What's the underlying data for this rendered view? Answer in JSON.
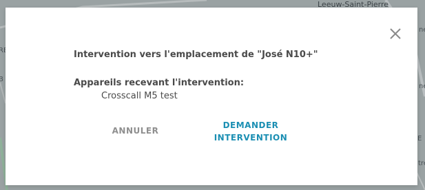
{
  "map": {
    "labels": {
      "town": "Leeuw-Saint-Pierre",
      "sub1": "ne",
      "sub2": "ne",
      "sub3": "E",
      "sub4": "tre",
      "left1": "RE",
      "left2": "B"
    }
  },
  "dialog": {
    "title": "Intervention vers l'emplacement de \"José N10+\"",
    "devices_heading": "Appareils recevant l'intervention:",
    "devices": [
      "Crosscall M5 test"
    ],
    "cancel_label": "ANNULER",
    "request_label_line1": "DEMANDER",
    "request_label_line2": "INTERVENTION"
  },
  "colors": {
    "primary": "#1b8fb3",
    "secondary_text": "#8f8f8f",
    "body_text": "#4a4a4a",
    "overlay": "#9aa2a3"
  }
}
